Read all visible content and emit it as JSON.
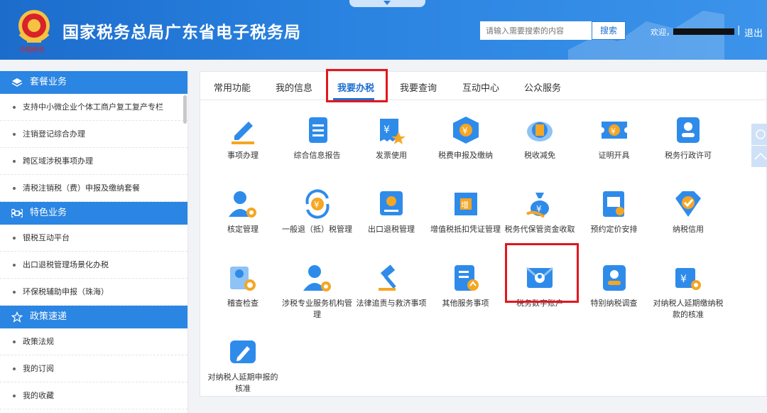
{
  "header": {
    "title": "国家税务总局广东省电子税务局",
    "emblem_text": "中国税务",
    "search_placeholder": "请输入需要搜索的内容",
    "search_button": "搜索",
    "welcome": "欢迎，",
    "separator": "|",
    "logout": "退出"
  },
  "sidebar": {
    "sections": [
      {
        "title": "套餐业务",
        "icon": "layers-icon",
        "items": [
          "支持中小微企业个体工商户复工复产专栏",
          "注销登记综合办理",
          "跨区域涉税事项办理",
          "清税注销税（费）申报及缴纳套餐"
        ]
      },
      {
        "title": "特色业务",
        "icon": "command-icon",
        "items": [
          "银税互动平台",
          "出口退税管理场景化办税",
          "环保税辅助申报（珠海）"
        ]
      },
      {
        "title": "政策速递",
        "icon": "star-icon",
        "items": [
          "政策法规",
          "我的订阅",
          "我的收藏"
        ]
      }
    ]
  },
  "tabs": [
    "常用功能",
    "我的信息",
    "我要办税",
    "我要查询",
    "互动中心",
    "公众服务"
  ],
  "active_tab": "我要办税",
  "grid": [
    {
      "label": "事项办理",
      "icon": "pen-icon"
    },
    {
      "label": "综合信息报告",
      "icon": "document-list-icon"
    },
    {
      "label": "发票使用",
      "icon": "invoice-icon"
    },
    {
      "label": "税费申报及缴纳",
      "icon": "cube-yuan-icon"
    },
    {
      "label": "税收减免",
      "icon": "tax-coin-icon"
    },
    {
      "label": "证明开具",
      "icon": "certificate-icon"
    },
    {
      "label": "税务行政许可",
      "icon": "user-card-icon"
    },
    {
      "label": "核定管理",
      "icon": "user-gear-icon"
    },
    {
      "label": "一般退（抵）税管理",
      "icon": "refund-cycle-icon"
    },
    {
      "label": "出口退税管理",
      "icon": "export-book-icon"
    },
    {
      "label": "增值税抵扣凭证管理",
      "icon": "vat-ticket-icon"
    },
    {
      "label": "税务代保管资金收取",
      "icon": "money-bag-icon"
    },
    {
      "label": "预约定价安排",
      "icon": "doc-search-icon"
    },
    {
      "label": "纳税信用",
      "icon": "diamond-check-icon"
    },
    {
      "label": "稽查检查",
      "icon": "user-search-icon"
    },
    {
      "label": "涉税专业服务机构管理",
      "icon": "user-gear-2-icon"
    },
    {
      "label": "法律追责与救济事项",
      "icon": "gavel-icon"
    },
    {
      "label": "其他服务事项",
      "icon": "list-upload-icon"
    },
    {
      "label": "税务数字账户",
      "icon": "digital-account-icon"
    },
    {
      "label": "特别纳税调查",
      "icon": "user-badge-icon"
    },
    {
      "label": "对纳税人延期缴纳税款的核准",
      "icon": "yuan-search-icon"
    },
    {
      "label": "对纳税人延期申报的核准",
      "icon": "edit-box-icon"
    }
  ],
  "colors": {
    "accent": "#1f6fd0",
    "header": "#2a7fdc",
    "highlight": "#e3161e",
    "icon_blue": "#2f8bea",
    "icon_orange": "#f5a623"
  }
}
